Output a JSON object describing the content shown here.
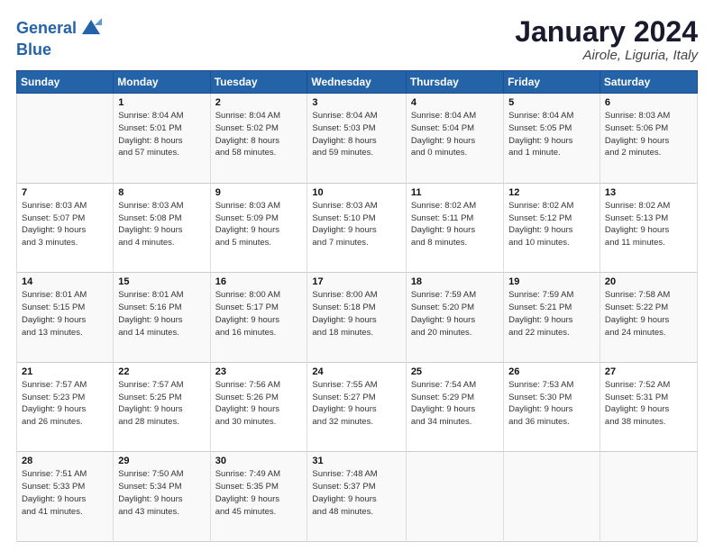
{
  "header": {
    "logo_line1": "General",
    "logo_line2": "Blue",
    "month": "January 2024",
    "location": "Airole, Liguria, Italy"
  },
  "days_of_week": [
    "Sunday",
    "Monday",
    "Tuesday",
    "Wednesday",
    "Thursday",
    "Friday",
    "Saturday"
  ],
  "weeks": [
    [
      {
        "day": "",
        "info": ""
      },
      {
        "day": "1",
        "info": "Sunrise: 8:04 AM\nSunset: 5:01 PM\nDaylight: 8 hours\nand 57 minutes."
      },
      {
        "day": "2",
        "info": "Sunrise: 8:04 AM\nSunset: 5:02 PM\nDaylight: 8 hours\nand 58 minutes."
      },
      {
        "day": "3",
        "info": "Sunrise: 8:04 AM\nSunset: 5:03 PM\nDaylight: 8 hours\nand 59 minutes."
      },
      {
        "day": "4",
        "info": "Sunrise: 8:04 AM\nSunset: 5:04 PM\nDaylight: 9 hours\nand 0 minutes."
      },
      {
        "day": "5",
        "info": "Sunrise: 8:04 AM\nSunset: 5:05 PM\nDaylight: 9 hours\nand 1 minute."
      },
      {
        "day": "6",
        "info": "Sunrise: 8:03 AM\nSunset: 5:06 PM\nDaylight: 9 hours\nand 2 minutes."
      }
    ],
    [
      {
        "day": "7",
        "info": "Sunrise: 8:03 AM\nSunset: 5:07 PM\nDaylight: 9 hours\nand 3 minutes."
      },
      {
        "day": "8",
        "info": "Sunrise: 8:03 AM\nSunset: 5:08 PM\nDaylight: 9 hours\nand 4 minutes."
      },
      {
        "day": "9",
        "info": "Sunrise: 8:03 AM\nSunset: 5:09 PM\nDaylight: 9 hours\nand 5 minutes."
      },
      {
        "day": "10",
        "info": "Sunrise: 8:03 AM\nSunset: 5:10 PM\nDaylight: 9 hours\nand 7 minutes."
      },
      {
        "day": "11",
        "info": "Sunrise: 8:02 AM\nSunset: 5:11 PM\nDaylight: 9 hours\nand 8 minutes."
      },
      {
        "day": "12",
        "info": "Sunrise: 8:02 AM\nSunset: 5:12 PM\nDaylight: 9 hours\nand 10 minutes."
      },
      {
        "day": "13",
        "info": "Sunrise: 8:02 AM\nSunset: 5:13 PM\nDaylight: 9 hours\nand 11 minutes."
      }
    ],
    [
      {
        "day": "14",
        "info": "Sunrise: 8:01 AM\nSunset: 5:15 PM\nDaylight: 9 hours\nand 13 minutes."
      },
      {
        "day": "15",
        "info": "Sunrise: 8:01 AM\nSunset: 5:16 PM\nDaylight: 9 hours\nand 14 minutes."
      },
      {
        "day": "16",
        "info": "Sunrise: 8:00 AM\nSunset: 5:17 PM\nDaylight: 9 hours\nand 16 minutes."
      },
      {
        "day": "17",
        "info": "Sunrise: 8:00 AM\nSunset: 5:18 PM\nDaylight: 9 hours\nand 18 minutes."
      },
      {
        "day": "18",
        "info": "Sunrise: 7:59 AM\nSunset: 5:20 PM\nDaylight: 9 hours\nand 20 minutes."
      },
      {
        "day": "19",
        "info": "Sunrise: 7:59 AM\nSunset: 5:21 PM\nDaylight: 9 hours\nand 22 minutes."
      },
      {
        "day": "20",
        "info": "Sunrise: 7:58 AM\nSunset: 5:22 PM\nDaylight: 9 hours\nand 24 minutes."
      }
    ],
    [
      {
        "day": "21",
        "info": "Sunrise: 7:57 AM\nSunset: 5:23 PM\nDaylight: 9 hours\nand 26 minutes."
      },
      {
        "day": "22",
        "info": "Sunrise: 7:57 AM\nSunset: 5:25 PM\nDaylight: 9 hours\nand 28 minutes."
      },
      {
        "day": "23",
        "info": "Sunrise: 7:56 AM\nSunset: 5:26 PM\nDaylight: 9 hours\nand 30 minutes."
      },
      {
        "day": "24",
        "info": "Sunrise: 7:55 AM\nSunset: 5:27 PM\nDaylight: 9 hours\nand 32 minutes."
      },
      {
        "day": "25",
        "info": "Sunrise: 7:54 AM\nSunset: 5:29 PM\nDaylight: 9 hours\nand 34 minutes."
      },
      {
        "day": "26",
        "info": "Sunrise: 7:53 AM\nSunset: 5:30 PM\nDaylight: 9 hours\nand 36 minutes."
      },
      {
        "day": "27",
        "info": "Sunrise: 7:52 AM\nSunset: 5:31 PM\nDaylight: 9 hours\nand 38 minutes."
      }
    ],
    [
      {
        "day": "28",
        "info": "Sunrise: 7:51 AM\nSunset: 5:33 PM\nDaylight: 9 hours\nand 41 minutes."
      },
      {
        "day": "29",
        "info": "Sunrise: 7:50 AM\nSunset: 5:34 PM\nDaylight: 9 hours\nand 43 minutes."
      },
      {
        "day": "30",
        "info": "Sunrise: 7:49 AM\nSunset: 5:35 PM\nDaylight: 9 hours\nand 45 minutes."
      },
      {
        "day": "31",
        "info": "Sunrise: 7:48 AM\nSunset: 5:37 PM\nDaylight: 9 hours\nand 48 minutes."
      },
      {
        "day": "",
        "info": ""
      },
      {
        "day": "",
        "info": ""
      },
      {
        "day": "",
        "info": ""
      }
    ]
  ]
}
